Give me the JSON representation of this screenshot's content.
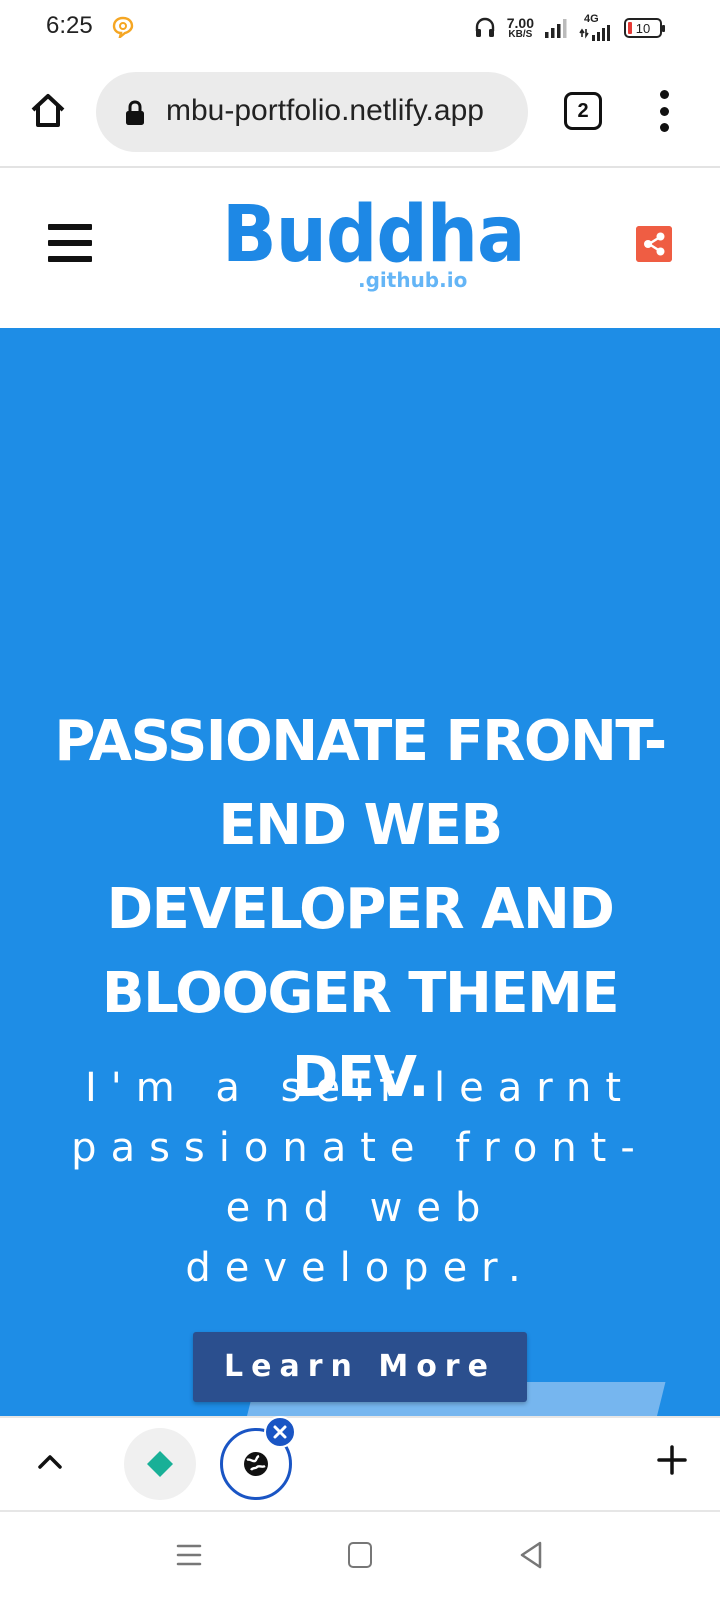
{
  "status_bar": {
    "time": "6:25",
    "net_speed_value": "7.00",
    "net_speed_unit": "KB/S",
    "network": "4G",
    "battery": "10",
    "icons": [
      "notification-icon",
      "headset-icon",
      "signal-icon",
      "mobile-data-icon",
      "battery-icon"
    ]
  },
  "browser": {
    "url": "mbu-portfolio.netlify.app",
    "tab_count": "2"
  },
  "site": {
    "logo_main": "Buddha",
    "logo_sub": ".github.io",
    "accent_color": "#1e8de6",
    "share_color": "#ef5d43"
  },
  "hero": {
    "title": "PASSIONATE FRONT-END WEB DEVELOPER AND BLOOGER THEME DEV.",
    "subtitle": "I'm a self learnt passionate front-end web developer.",
    "cta_label": "Learn More",
    "cta_color": "#2b4f8e"
  },
  "tab_strip": {
    "icons": [
      "chevron-up-icon",
      "site-favicon-icon",
      "globe-tab-icon",
      "close-tab-icon",
      "plus-icon"
    ]
  },
  "nav_bar": {
    "icons": [
      "recents-icon",
      "home-icon",
      "back-icon"
    ]
  }
}
